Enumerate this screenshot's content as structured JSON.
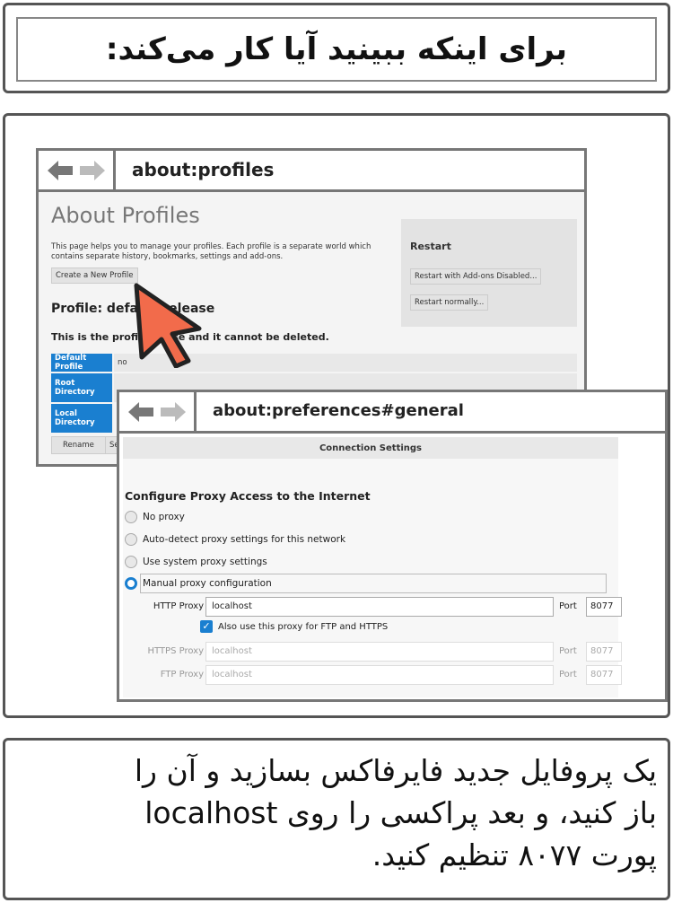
{
  "top": {
    "title": "برای اینکه ببینید آیا کار می‌کند:"
  },
  "window1": {
    "url": "about:profiles",
    "about_title": "About Profiles",
    "description": "This page helps you to manage your profiles. Each profile is a separate world which contains separate history, bookmarks, settings and add-ons.",
    "create_button": "Create a New Profile",
    "profile_heading": "Profile: default-release",
    "profile_note": "This is the profile in use and it cannot be deleted.",
    "restart_title": "Restart",
    "restart_addons": "Restart with Add-ons Disabled...",
    "restart_normal": "Restart normally...",
    "rows": {
      "default_label": "Default Profile",
      "default_value": "no",
      "root_label": "Root Directory",
      "root_value": "",
      "local_label": "Local Directory"
    },
    "rename_button": "Rename",
    "second_button": "Se"
  },
  "window2": {
    "url": "about:preferences#general",
    "conn_title": "Connection Settings",
    "proxy_heading": "Configure Proxy Access to the Internet",
    "options": {
      "no_proxy": "No proxy",
      "auto_detect": "Auto-detect proxy settings for this network",
      "system": "Use system proxy settings",
      "manual": "Manual proxy configuration"
    },
    "selected_option": "manual",
    "http": {
      "label": "HTTP Proxy",
      "value": "localhost",
      "port_label": "Port",
      "port": "8077"
    },
    "also_use": "Also use this proxy for FTP and HTTPS",
    "also_use_checked": true,
    "https": {
      "label": "HTTPS Proxy",
      "value": "localhost",
      "port_label": "Port",
      "port": "8077"
    },
    "ftp": {
      "label": "FTP Proxy",
      "value": "localhost",
      "port_label": "Port",
      "port": "8077"
    }
  },
  "bottom": {
    "line1": "یک پروفایل جدید فایرفاکس بسازید و آن را",
    "line2": "باز کنید، و بعد پراکسی را روی localhost",
    "line3": "پورت ۸۰۷۷ تنظیم کنید."
  },
  "colors": {
    "accent": "#1a7fd0",
    "cursor": "#f26b4b",
    "border": "#555555"
  }
}
